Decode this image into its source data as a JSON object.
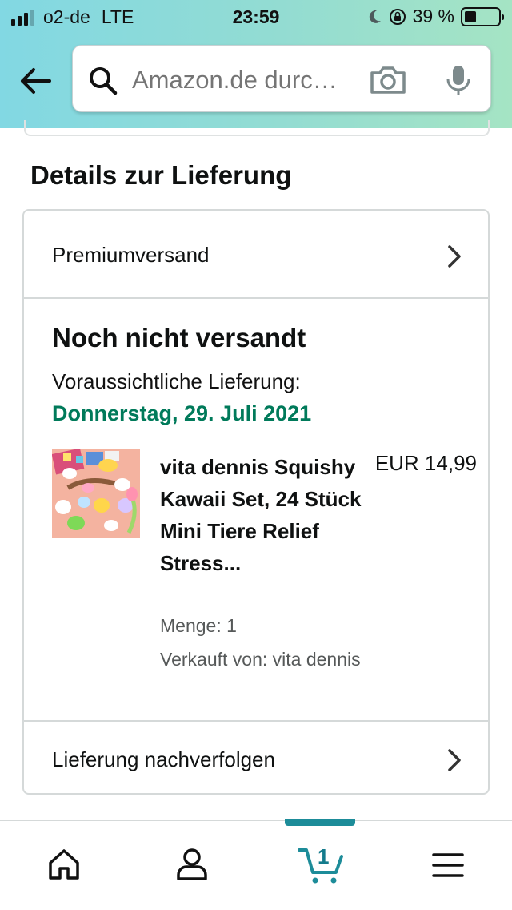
{
  "status_bar": {
    "carrier": "o2-de",
    "network": "LTE",
    "time": "23:59",
    "battery": "39 %"
  },
  "search": {
    "placeholder": "Amazon.de durc…"
  },
  "section_title": "Details zur Lieferung",
  "shipping": {
    "method": "Premiumversand"
  },
  "shipment": {
    "status": "Noch nicht versandt",
    "delivery_label": "Voraussichtliche Lieferung:",
    "delivery_date": "Donnerstag, 29. Juli 2021"
  },
  "product": {
    "name": "vita dennis Squishy Kawaii Set, 24 Stück Mini Tiere Relief Stress...",
    "price": "EUR 14,99",
    "quantity": "Menge: 1",
    "seller": "Verkauft von: vita dennis"
  },
  "track": {
    "label": "Lieferung nachverfolgen"
  },
  "bottom_nav": {
    "items": [
      "home-icon",
      "account-icon",
      "cart-icon",
      "menu-icon"
    ],
    "cart_count": "1",
    "active": "cart"
  },
  "colors": {
    "header_start": "#82d8e3",
    "header_end": "#a5e4c4",
    "delivery_green": "#007a5a",
    "active_teal": "#1d8c99"
  }
}
